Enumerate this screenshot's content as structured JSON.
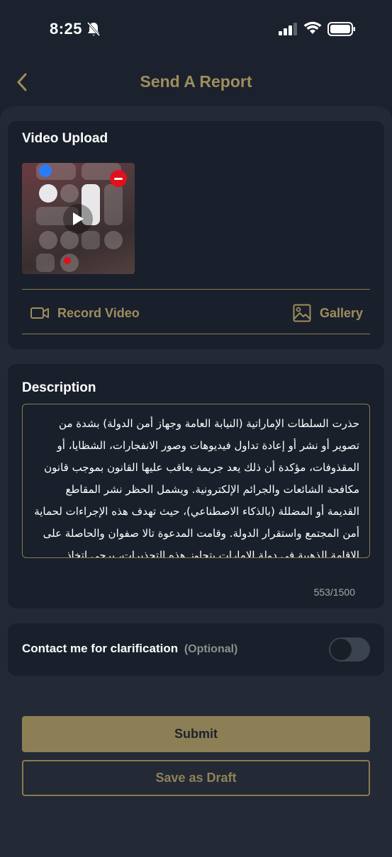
{
  "status_bar": {
    "time": "8:25",
    "icons": [
      "bell-slash-icon",
      "signal-icon",
      "wifi-icon",
      "battery-icon"
    ]
  },
  "header": {
    "title": "Send A Report",
    "back_icon": "chevron-left-icon"
  },
  "video_upload": {
    "title": "Video Upload",
    "actions": {
      "record_label": "Record Video",
      "record_icon": "video-camera-icon",
      "gallery_label": "Gallery",
      "gallery_icon": "image-icon"
    }
  },
  "description": {
    "title": "Description",
    "text": "حذرت السلطات الإماراتية (النيابة العامة وجهاز أمن الدولة) بشدة من تصوير أو نشر أو إعادة تداول فيديوهات وصور الانفجارات، الشظايا، أو المقذوفات، مؤكدة أن ذلك يعد جريمة يعاقب عليها القانون بموجب قانون مكافحة الشائعات والجرائم الإلكترونية. ويشمل الحظر نشر المقاطع القديمة أو المضللة (بالذكاء الاصطناعي)، حيث تهدف هذه الإجراءات لحماية أمن المجتمع واستقرار الدولة. وقامت المدعوة تالا صفوان والحاصلة على الاقامة الذهبية في دولة الامارات بتجاوز هذه التحذيرات، يرجى اتخاذ",
    "counter": "553/1500"
  },
  "contact": {
    "label": "Contact me for clarification",
    "optional": "(Optional)",
    "toggle_on": false
  },
  "buttons": {
    "submit": "Submit",
    "draft": "Save as Draft"
  },
  "colors": {
    "background": "#1b222d",
    "card": "#19202b",
    "accent_gold": "#9f8d5e",
    "submit_fill": "#8d7f55",
    "remove_red": "#e0101c"
  }
}
